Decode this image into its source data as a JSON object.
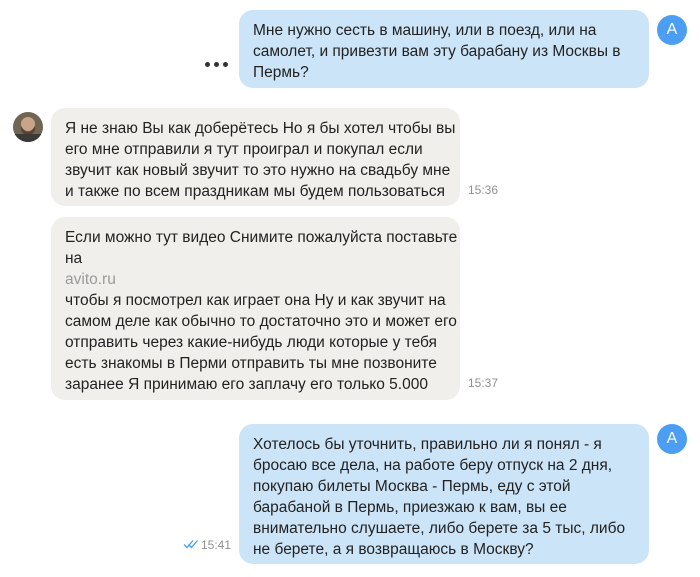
{
  "messages": [
    {
      "direction": "outgoing",
      "lines": [
        "Мне нужно сесть в машину, или в поезд, или на",
        "самолет, и привезти вам эту барабану из Москвы в",
        "Пермь?"
      ]
    },
    {
      "direction": "incoming",
      "time": "15:36",
      "lines": [
        "Я не знаю Вы как доберётесь Но я бы хотел чтобы вы",
        "его мне отправили я тут проиграл и покупал если",
        "звучит как новый звучит то это нужно на свадьбу мне",
        "и также по всем праздникам мы будем пользоваться"
      ]
    },
    {
      "direction": "incoming",
      "time": "15:37",
      "lines": [
        "Если можно тут видео Снимите пожалуйста поставьте",
        "на",
        "avito.ru",
        "чтобы я посмотрел как играет она Ну и как звучит на",
        "самом деле как обычно то достаточно это и может его",
        "отправить через какие-нибудь люди которые у тебя",
        "есть знакомы в Перми отправить ты мне позвоните",
        "заранее Я принимаю его заплачу его только 5.000"
      ]
    },
    {
      "direction": "outgoing",
      "time": "15:41",
      "lines": [
        "Хотелось бы уточнить, правильно ли я понял - я",
        "бросаю все дела, на работе беру отпуск на 2 дня,",
        "покупаю билеты Москва - Пермь, еду с этой",
        "барабаной в Пермь, приезжаю к вам, вы ее",
        "внимательно слушаете, либо берете за 5 тыс, либо",
        "не берете, а я возвращаюсь в Москву?"
      ]
    }
  ],
  "own_avatar_letter": "A",
  "icons": {
    "more": "more-dots-icon",
    "read": "double-check-icon",
    "contact_avatar": "contact-photo-icon"
  },
  "colors": {
    "outgoing_bubble": "#cce4f7",
    "incoming_bubble": "#f1efeb",
    "avatar": "#4b9ef2",
    "link": "#9a9a9a",
    "read_check": "#4b9ef2"
  }
}
